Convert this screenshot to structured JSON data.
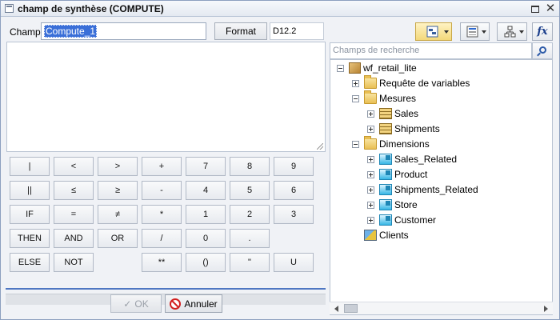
{
  "window": {
    "title": "champ de synthèse (COMPUTE)"
  },
  "form": {
    "champ_label": "Champ",
    "champ_value": "Compute_1",
    "format_button": "Format",
    "format_value": "D12.2",
    "expression_value": ""
  },
  "keypad": {
    "keys": [
      "|",
      "<",
      ">",
      "+",
      "7",
      "8",
      "9",
      "||",
      "≤",
      "≥",
      "-",
      "4",
      "5",
      "6",
      "IF",
      "=",
      "≠",
      "*",
      "1",
      "2",
      "3",
      "THEN",
      "AND",
      "OR",
      "/",
      "0",
      ".",
      "",
      "ELSE",
      "NOT",
      "",
      "**",
      "()",
      "\"",
      "U"
    ]
  },
  "actions": {
    "ok_label": "OK",
    "cancel_label": "Annuler"
  },
  "search": {
    "placeholder": "Champs de recherche"
  },
  "tree": {
    "root": "wf_retail_lite",
    "folder_variables": "Requête de variables",
    "folder_measures": "Mesures",
    "measures": [
      "Sales",
      "Shipments"
    ],
    "folder_dimensions": "Dimensions",
    "dimensions": [
      "Sales_Related",
      "Product",
      "Shipments_Related",
      "Store",
      "Customer"
    ],
    "clients": "Clients"
  },
  "icons": {
    "app": "window-icon",
    "toolbar": [
      "view-icon",
      "list-icon",
      "hierarchy-icon",
      "function-icon"
    ],
    "search": "search-icon"
  }
}
